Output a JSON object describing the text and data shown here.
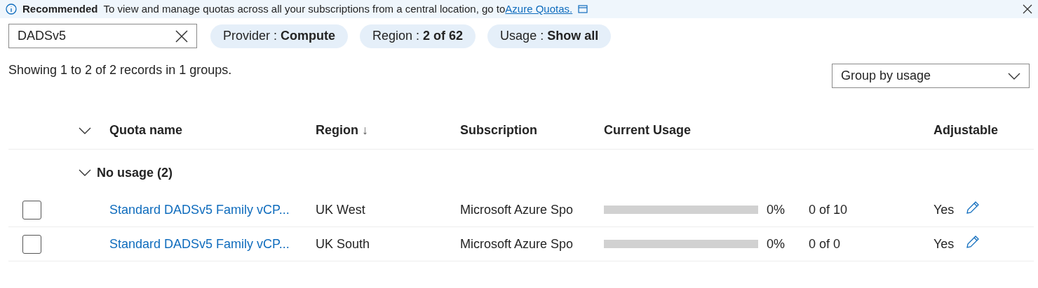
{
  "banner": {
    "title": "Recommended",
    "text": "To view and manage quotas across all your subscriptions from a central location, go to",
    "link": "Azure Quotas."
  },
  "search": {
    "value": "DADSv5"
  },
  "filters": [
    "Provider : **Compute**",
    "Region : **2 of 62**",
    "Usage : **Show all**"
  ],
  "summary": "Showing 1 to 2 of 2 records in 1 groups.",
  "group_by": {
    "value": "Group by usage"
  },
  "table": {
    "columns": [
      {
        "label": "Quota name"
      },
      {
        "label": "Region",
        "sort": "↓"
      },
      {
        "label": "Subscription"
      },
      {
        "label": "Current Usage"
      },
      {
        "label": "Adjustable"
      }
    ],
    "groups": [
      {
        "label": "No usage (2)",
        "expanded": true,
        "rows": [
          {
            "checked": false,
            "name": "Standard DADSv5 Family vCP...",
            "region": "UK West",
            "subscription": "Microsoft Azure Spo",
            "level": 0,
            "percent": "0%",
            "count": "0 of 10",
            "adjustable": "Yes"
          },
          {
            "checked": false,
            "name": "Standard DADSv5 Family vCP...",
            "region": "UK South",
            "subscription": "Microsoft Azure Spo",
            "level": 0,
            "percent": "0%",
            "count": "0 of 0",
            "adjustable": "Yes"
          }
        ]
      }
    ]
  }
}
